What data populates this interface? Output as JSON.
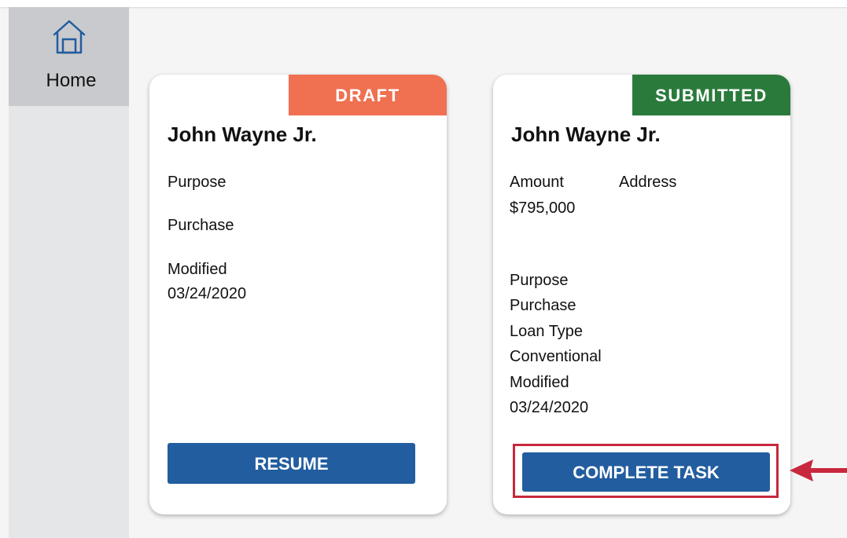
{
  "sidebar": {
    "home_label": "Home",
    "home_icon": "home-icon"
  },
  "cards": [
    {
      "status": "DRAFT",
      "status_color": "#f07052",
      "name": "John Wayne Jr.",
      "purpose_label": "Purpose",
      "purpose_value": "Purchase",
      "modified_label": "Modified",
      "modified_value": "03/24/2020",
      "button_label": "RESUME"
    },
    {
      "status": "SUBMITTED",
      "status_color": "#2a7a3c",
      "name": "John Wayne Jr.",
      "amount_label": "Amount",
      "amount_value": "$795,000",
      "address_label": "Address",
      "purpose_label": "Purpose",
      "purpose_value": "Purchase",
      "loan_type_label": "Loan Type",
      "loan_type_value": "Conventional",
      "modified_label": "Modified",
      "modified_value": "03/24/2020",
      "button_label": "COMPLETE TASK"
    }
  ],
  "colors": {
    "button_blue": "#225d9f",
    "highlight_red": "#c8283d"
  }
}
